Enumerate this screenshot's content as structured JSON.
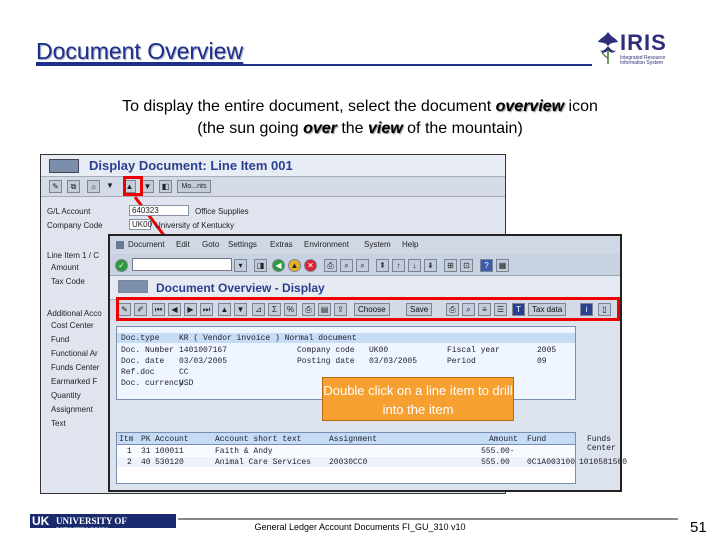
{
  "slide": {
    "title": "Document Overview",
    "instruction_line1_a": "To display the entire document, select the document ",
    "instruction_line1_em": "overview",
    "instruction_line1_b": " icon",
    "instruction_line2_a": "(the sun going ",
    "instruction_line2_em1": "over",
    "instruction_line2_mid": " the ",
    "instruction_line2_em2": "view",
    "instruction_line2_b": " of the mountain)",
    "callout": "Double click on a line item to drill into the item",
    "footer": "General Ledger Account Documents FI_GU_310 v10",
    "page_number": "51"
  },
  "logo": {
    "name": "IRIS",
    "subtitle": "Integrated Resource Information System"
  },
  "footer_logo": {
    "short": "UK",
    "name": "UNIVERSITY OF KENTUCKY"
  },
  "back_window": {
    "title": "Display Document: Line Item 001",
    "toolbar_label": "Mo...nts",
    "fields": [
      {
        "label": "G/L Account",
        "value": "640323",
        "desc": "Office Supplies"
      },
      {
        "label": "Company Code",
        "value": "UK00",
        "desc": "University of Kentucky"
      }
    ],
    "side_labels": [
      "Line Item 1 / C",
      "Amount",
      "Tax Code",
      "Additional Acco",
      "Cost Center",
      "Fund",
      "Functional Ar",
      "Funds Center",
      "Earmarked F",
      "Quantity",
      "Assignment",
      "Text"
    ]
  },
  "front_window": {
    "menu": [
      "Document",
      "Edit",
      "Goto",
      "Settings",
      "Extras",
      "Environment",
      "System",
      "Help"
    ],
    "title": "Document Overview - Display",
    "toolbar_labels": {
      "choose": "Choose",
      "save": "Save",
      "tax": "Tax data"
    },
    "header": {
      "doc_type_label": "Doc.type",
      "doc_type": "KR ( Vendor invoice ) Normal document",
      "doc_number_label": "Doc. Number",
      "doc_number": "1401007167",
      "company_code_label": "Company code",
      "company_code": "UK00",
      "fiscal_year_label": "Fiscal year",
      "fiscal_year": "2005",
      "doc_date_label": "Doc. date",
      "doc_date": "03/03/2005",
      "posting_date_label": "Posting date",
      "posting_date": "03/03/2005",
      "period_label": "Period",
      "period": "09",
      "ref_doc_label": "Ref.doc",
      "ref_doc": "CC",
      "currency_label": "Doc. currency",
      "currency": "USD"
    },
    "grid": {
      "columns": [
        "Itm",
        "PK",
        "Account",
        "Account short text",
        "Assignment",
        "Amount",
        "Fund",
        "Funds Center"
      ],
      "rows": [
        {
          "itm": "1",
          "pk": "31",
          "account": "100011",
          "short_text": "Faith & Andy",
          "assignment": "",
          "amount": "555.00-",
          "fund": "",
          "funds_center": ""
        },
        {
          "itm": "2",
          "pk": "40",
          "account": "530120",
          "short_text": "Animal Care Services",
          "assignment": "20030CC0",
          "amount": "555.00",
          "fund": "0C1A003100",
          "funds_center": "1010581500"
        }
      ]
    }
  }
}
